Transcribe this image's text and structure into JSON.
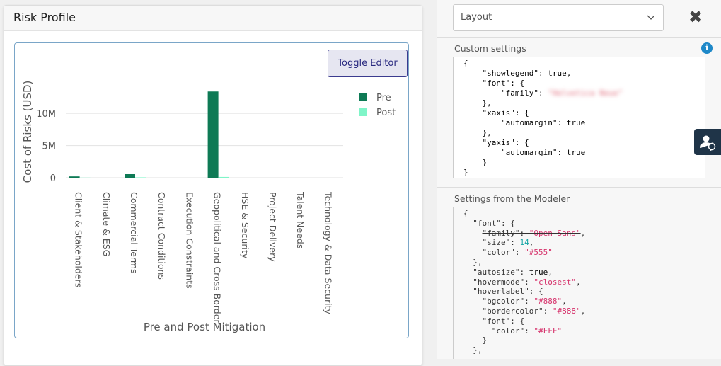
{
  "card": {
    "title": "Risk Profile",
    "toggle_label": "Toggle Editor"
  },
  "chart_data": {
    "type": "bar",
    "xlabel": "Pre and Post Mitigation",
    "ylabel": "Cost of Risks (USD)",
    "ylim": [
      0,
      14000000
    ],
    "yticks": [
      "0",
      "5M",
      "10M"
    ],
    "ytick_values": [
      0,
      5000000,
      10000000
    ],
    "categories": [
      "Client & Stakeholders",
      "Climate & ESG",
      "Commercial Terms",
      "Contract Conditions",
      "Execution Constraints",
      "Geopolitical and Cross Border",
      "HSE & Security",
      "Project Delivery",
      "Talent Needs",
      "Technology & Data Security"
    ],
    "series": [
      {
        "name": "Pre",
        "color": "#0e7a55",
        "values": [
          200000,
          0,
          550000,
          0,
          0,
          13400000,
          0,
          0,
          0,
          0
        ]
      },
      {
        "name": "Post",
        "color": "#7ff5c8",
        "values": [
          20000,
          0,
          60000,
          0,
          0,
          120000,
          0,
          0,
          0,
          0
        ]
      }
    ],
    "legend": "top-right",
    "grid": true
  },
  "right": {
    "layout_select": "Layout",
    "close_label": "✖",
    "custom_settings_label": "Custom settings",
    "modeler_settings_label": "Settings from the Modeler"
  }
}
